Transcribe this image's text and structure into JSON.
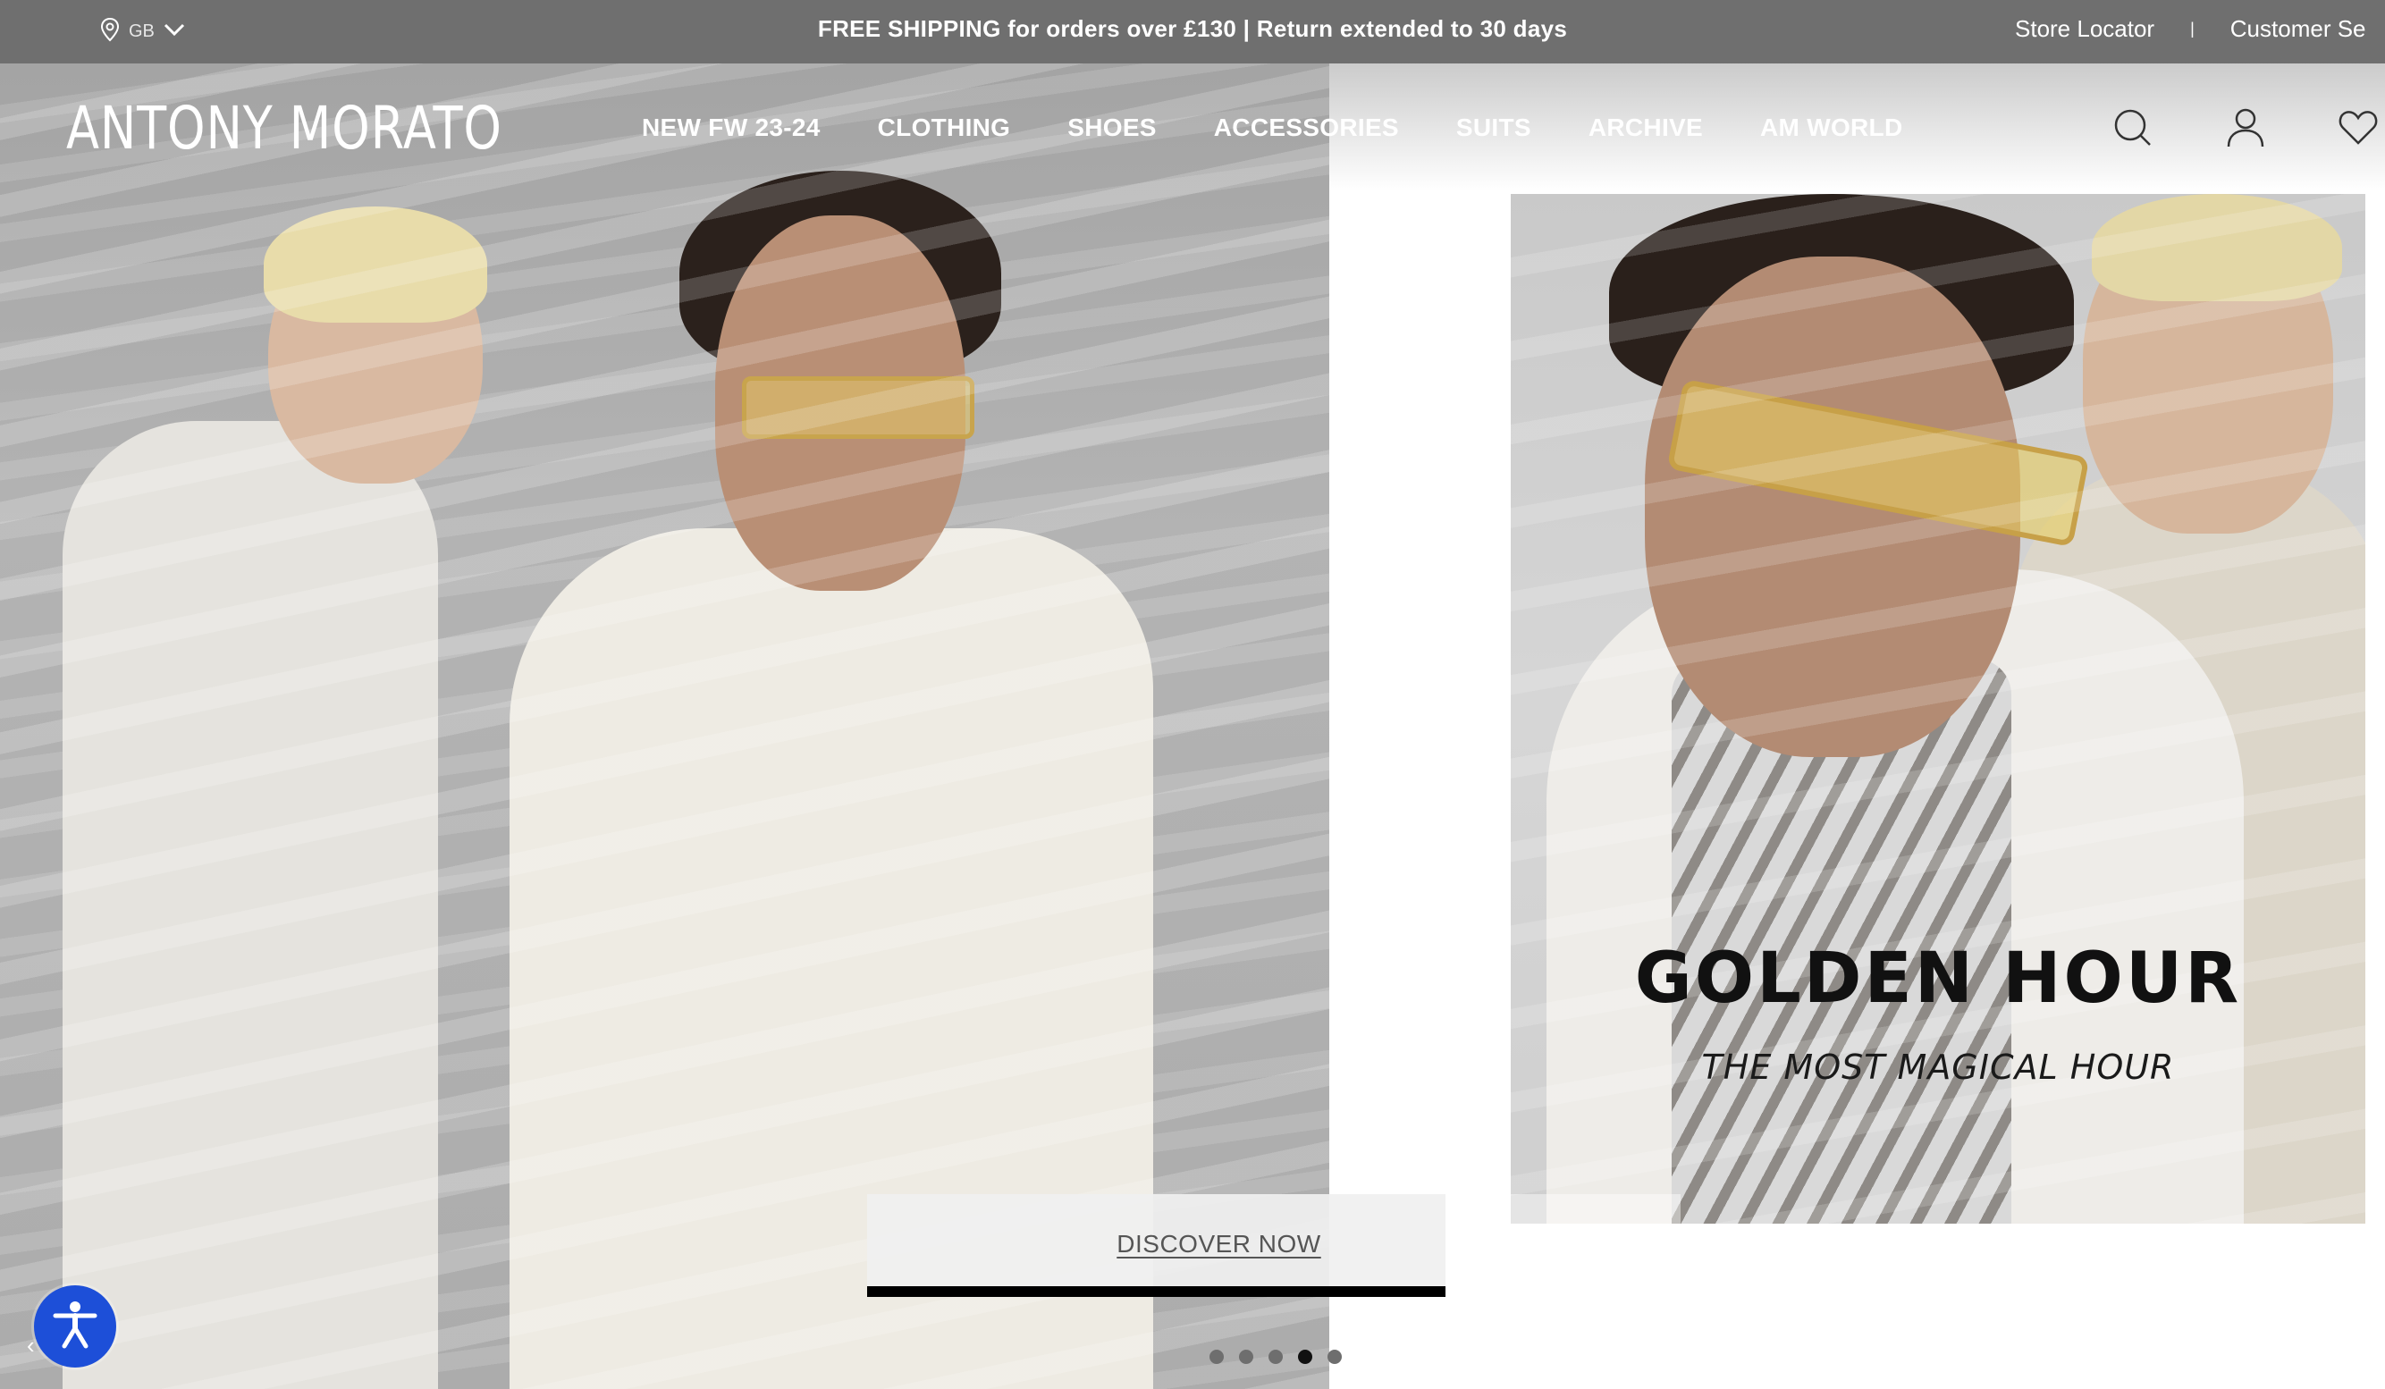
{
  "topbar": {
    "region": "GB",
    "promo": "FREE SHIPPING for orders over £130 | Return extended to 30 days",
    "store_locator": "Store Locator",
    "separator": "|",
    "customer_service": "Customer Se"
  },
  "brand": {
    "logo": "ANTONY MORATO"
  },
  "nav": {
    "items": [
      {
        "label": "NEW FW 23-24"
      },
      {
        "label": "CLOTHING"
      },
      {
        "label": "SHOES"
      },
      {
        "label": "ACCESSORIES"
      },
      {
        "label": "SUITS"
      },
      {
        "label": "ARCHIVE"
      },
      {
        "label": "AM WORLD"
      }
    ]
  },
  "hero": {
    "headline": "GOLDEN HOUR",
    "subheadline": "THE MOST MAGICAL HOUR",
    "cta": "DISCOVER NOW",
    "slides_total": 5,
    "active_slide": 4
  },
  "icons": {
    "location": "map-pin-icon",
    "chevron": "chevron-down-icon",
    "search": "search-icon",
    "account": "user-icon",
    "wishlist": "heart-icon",
    "accessibility": "accessibility-icon"
  },
  "colors": {
    "topbar_bg": "#6f6f6f",
    "accessibility_bg": "#1d4fd8",
    "progress_bar": "#000000"
  }
}
